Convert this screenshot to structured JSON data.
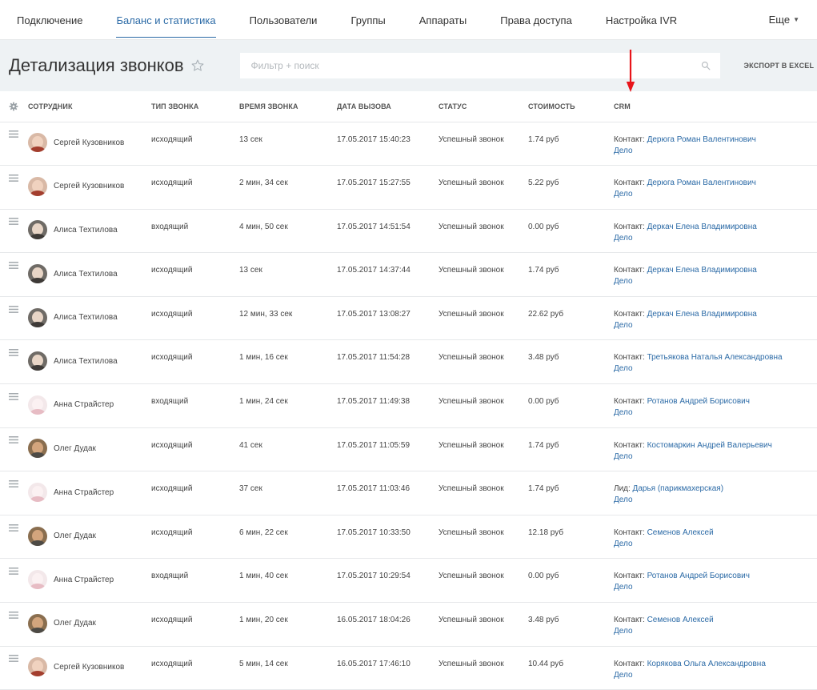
{
  "nav": {
    "tabs": [
      {
        "label": "Подключение",
        "active": false
      },
      {
        "label": "Баланс и статистика",
        "active": true
      },
      {
        "label": "Пользователи",
        "active": false
      },
      {
        "label": "Группы",
        "active": false
      },
      {
        "label": "Аппараты",
        "active": false
      },
      {
        "label": "Права доступа",
        "active": false
      },
      {
        "label": "Настройка IVR",
        "active": false
      }
    ],
    "more_label": "Еще"
  },
  "header": {
    "title": "Детализация звонков",
    "search_placeholder": "Фильтр + поиск",
    "export_label": "Экспорт в Excel"
  },
  "table": {
    "columns": [
      "Сотрудник",
      "Тип звонка",
      "Время звонка",
      "Дата вызова",
      "Статус",
      "Стоимость",
      "CRM"
    ],
    "rows": [
      {
        "employee": "Сергей Кузовников",
        "avatar": "sergey",
        "type": "исходящий",
        "duration": "13 сек",
        "date": "17.05.2017 15:40:23",
        "status": "Успешный звонок",
        "cost": "1.74 руб",
        "crm_prefix": "Контакт:",
        "crm_name": "Дерюга Роман Валентинович",
        "crm_deal": "Дело"
      },
      {
        "employee": "Сергей Кузовников",
        "avatar": "sergey",
        "type": "исходящий",
        "duration": "2 мин, 34 сек",
        "date": "17.05.2017 15:27:55",
        "status": "Успешный звонок",
        "cost": "5.22 руб",
        "crm_prefix": "Контакт:",
        "crm_name": "Дерюга Роман Валентинович",
        "crm_deal": "Дело"
      },
      {
        "employee": "Алиса Техтилова",
        "avatar": "alisa",
        "type": "входящий",
        "duration": "4 мин, 50 сек",
        "date": "17.05.2017 14:51:54",
        "status": "Успешный звонок",
        "cost": "0.00 руб",
        "crm_prefix": "Контакт:",
        "crm_name": "Деркач Елена Владимировна",
        "crm_deal": "Дело"
      },
      {
        "employee": "Алиса Техтилова",
        "avatar": "alisa",
        "type": "исходящий",
        "duration": "13 сек",
        "date": "17.05.2017 14:37:44",
        "status": "Успешный звонок",
        "cost": "1.74 руб",
        "crm_prefix": "Контакт:",
        "crm_name": "Деркач Елена Владимировна",
        "crm_deal": "Дело"
      },
      {
        "employee": "Алиса Техтилова",
        "avatar": "alisa",
        "type": "исходящий",
        "duration": "12 мин, 33 сек",
        "date": "17.05.2017 13:08:27",
        "status": "Успешный звонок",
        "cost": "22.62 руб",
        "crm_prefix": "Контакт:",
        "crm_name": "Деркач Елена Владимировна",
        "crm_deal": "Дело"
      },
      {
        "employee": "Алиса Техтилова",
        "avatar": "alisa",
        "type": "исходящий",
        "duration": "1 мин, 16 сек",
        "date": "17.05.2017 11:54:28",
        "status": "Успешный звонок",
        "cost": "3.48 руб",
        "crm_prefix": "Контакт:",
        "crm_name": "Третьякова Наталья Александровна",
        "crm_deal": "Дело"
      },
      {
        "employee": "Анна Страйстер",
        "avatar": "anna",
        "type": "входящий",
        "duration": "1 мин, 24 сек",
        "date": "17.05.2017 11:49:38",
        "status": "Успешный звонок",
        "cost": "0.00 руб",
        "crm_prefix": "Контакт:",
        "crm_name": "Ротанов Андрей Борисович",
        "crm_deal": "Дело"
      },
      {
        "employee": "Олег Дудак",
        "avatar": "oleg",
        "type": "исходящий",
        "duration": "41 сек",
        "date": "17.05.2017 11:05:59",
        "status": "Успешный звонок",
        "cost": "1.74 руб",
        "crm_prefix": "Контакт:",
        "crm_name": "Костомаркин Андрей Валерьевич",
        "crm_deal": "Дело"
      },
      {
        "employee": "Анна Страйстер",
        "avatar": "anna",
        "type": "исходящий",
        "duration": "37 сек",
        "date": "17.05.2017 11:03:46",
        "status": "Успешный звонок",
        "cost": "1.74 руб",
        "crm_prefix": "Лид:",
        "crm_name": "Дарья (парикмахерская)",
        "crm_deal": "Дело"
      },
      {
        "employee": "Олег Дудак",
        "avatar": "oleg",
        "type": "исходящий",
        "duration": "6 мин, 22 сек",
        "date": "17.05.2017 10:33:50",
        "status": "Успешный звонок",
        "cost": "12.18 руб",
        "crm_prefix": "Контакт:",
        "crm_name": "Семенов Алексей",
        "crm_deal": "Дело"
      },
      {
        "employee": "Анна Страйстер",
        "avatar": "anna",
        "type": "входящий",
        "duration": "1 мин, 40 сек",
        "date": "17.05.2017 10:29:54",
        "status": "Успешный звонок",
        "cost": "0.00 руб",
        "crm_prefix": "Контакт:",
        "crm_name": "Ротанов Андрей Борисович",
        "crm_deal": "Дело"
      },
      {
        "employee": "Олег Дудак",
        "avatar": "oleg",
        "type": "исходящий",
        "duration": "1 мин, 20 сек",
        "date": "16.05.2017 18:04:26",
        "status": "Успешный звонок",
        "cost": "3.48 руб",
        "crm_prefix": "Контакт:",
        "crm_name": "Семенов Алексей",
        "crm_deal": "Дело"
      },
      {
        "employee": "Сергей Кузовников",
        "avatar": "sergey",
        "type": "исходящий",
        "duration": "5 мин, 14 сек",
        "date": "16.05.2017 17:46:10",
        "status": "Успешный звонок",
        "cost": "10.44 руб",
        "crm_prefix": "Контакт:",
        "crm_name": "Корякова Ольга Александровна",
        "crm_deal": "Дело"
      }
    ]
  },
  "colors": {
    "accent": "#2b6aa6",
    "header_bg": "#eef2f4",
    "annotation_arrow": "#e8141a"
  },
  "icons": {
    "star": "star-outline-icon",
    "search": "search-icon",
    "settings": "gear-icon",
    "drag": "drag-handle-icon",
    "more": "chevron-down-icon"
  }
}
